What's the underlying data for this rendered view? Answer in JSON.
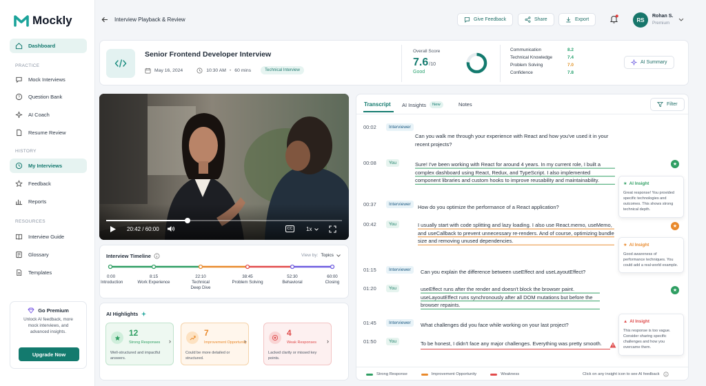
{
  "app": {
    "name": "Mockly",
    "brand_color": "#1ba39a"
  },
  "sidebar": {
    "dashboard": "Dashboard",
    "sections": {
      "practice": "PRACTICE",
      "history": "HISTORY",
      "resources": "RESOURCES"
    },
    "practice": [
      "Mock Interviews",
      "Question Bank",
      "AI Coach",
      "Resume Review"
    ],
    "history": [
      "My Interviews",
      "Feedback",
      "Reports"
    ],
    "resources": [
      "Interview Guide",
      "Glossary",
      "Templates"
    ],
    "premium": {
      "title": "Go Premium",
      "text": "Unlock AI feedback, more mock interviews, and advanced insights.",
      "button": "Upgrade Now"
    }
  },
  "header": {
    "title": "Interview Playback & Review",
    "give_feedback": "Give Feedback",
    "share": "Share",
    "export": "Export",
    "user": {
      "initials": "RS",
      "name": "Rohan S.",
      "plan": "Premium"
    }
  },
  "summary": {
    "title": "Senior Frontend Developer Interview",
    "date": "May 16, 2024",
    "time": "10:30 AM",
    "duration": "60 mins",
    "tag": "Technical Interview",
    "score_label": "Overall Score",
    "score": "7.6",
    "score_max": "/10",
    "score_rating": "Good",
    "score_fraction": 0.76,
    "metrics": [
      {
        "label": "Communication",
        "value": "8.2"
      },
      {
        "label": "Technical Knowledge",
        "value": "7.4"
      },
      {
        "label": "Problem Solving",
        "value": "7.0"
      },
      {
        "label": "Confidence",
        "value": "7.8"
      }
    ],
    "ai_summary": "AI Summary"
  },
  "video": {
    "time": "20:42 / 60:00",
    "speed": "1x",
    "progress": 0.345
  },
  "timeline": {
    "title": "Interview Timeline",
    "view_by": "View by:",
    "view_value": "Topics",
    "marks": [
      {
        "time": "0:00",
        "label": "Introduction"
      },
      {
        "time": "8:15",
        "label": "Work Experience"
      },
      {
        "time": "22:10",
        "label": "Technical Deep Dive"
      },
      {
        "time": "38:45",
        "label": "Problem Solving"
      },
      {
        "time": "52:30",
        "label": "Behavioral"
      },
      {
        "time": "60:00",
        "label": "Closing"
      }
    ]
  },
  "highlights": {
    "title": "AI Highlights",
    "cards": [
      {
        "count": "12",
        "label": "Strong Responses",
        "desc": "Well-structured and impactful answers.",
        "color": "#2e9e62"
      },
      {
        "count": "7",
        "label": "Improvement Opportunity",
        "desc": "Could be more detailed or structured.",
        "color": "#e9892b"
      },
      {
        "count": "4",
        "label": "Weak Responses",
        "desc": "Lacked clarity or missed key points.",
        "color": "#de4b4b"
      }
    ]
  },
  "tabs": {
    "transcript": "Transcript",
    "ai_insights": "AI Insights",
    "new_badge": "New",
    "notes": "Notes",
    "filter": "Filter"
  },
  "transcript": [
    {
      "time": "00:02",
      "speaker": "Interviewer",
      "text": "Can you walk me through your experience with React and how you've used it in your recent projects?"
    },
    {
      "time": "00:08",
      "speaker": "You",
      "text": "Sure! I've been working with React for around 4 years. In my current role, I built a complex dashboard using React, Redux, and TypeScript. I also implemented component libraries and custom hooks to improve reusability and maintainability."
    },
    {
      "time": "00:37",
      "speaker": "Interviewer",
      "text": "How do you optimize the performance of a React application?"
    },
    {
      "time": "00:42",
      "speaker": "You",
      "text": "I usually start with code splitting and lazy loading. I also use React.memo, useMemo, and useCallback to prevent unnecessary re-renders. And of course, optimizing bundle size and removing unused dependencies."
    },
    {
      "time": "01:15",
      "speaker": "Interviewer",
      "text": "Can you explain the difference between useEffect and useLayoutEffect?"
    },
    {
      "time": "01:20",
      "speaker": "You",
      "text": "useEffect runs after the render and doesn't block the browser paint. useLayoutEffect runs synchronously after all DOM mutations but before the browser repaints."
    },
    {
      "time": "01:45",
      "speaker": "Interviewer",
      "text": "What challenges did you face while working on your last project?"
    },
    {
      "time": "01:50",
      "speaker": "You",
      "text": "To be honest, I didn't face any major challenges. Everything was pretty smooth."
    }
  ],
  "insights": [
    {
      "title": "AI Insight",
      "text": "Great response! You provided specific technologies and outcomes. This shows strong technical depth."
    },
    {
      "title": "AI Insight",
      "text": "Good awareness of performance techniques. You could add a real-world example."
    },
    {
      "title": "AI Insight",
      "text": "This response is too vague. Consider sharing specific challenges and how you overcame them."
    }
  ],
  "legend": {
    "strong": "Strong Response",
    "improve": "Improvement Opportunity",
    "weak": "Weakness",
    "hint": "Click on any insight icon to see AI feedback"
  }
}
